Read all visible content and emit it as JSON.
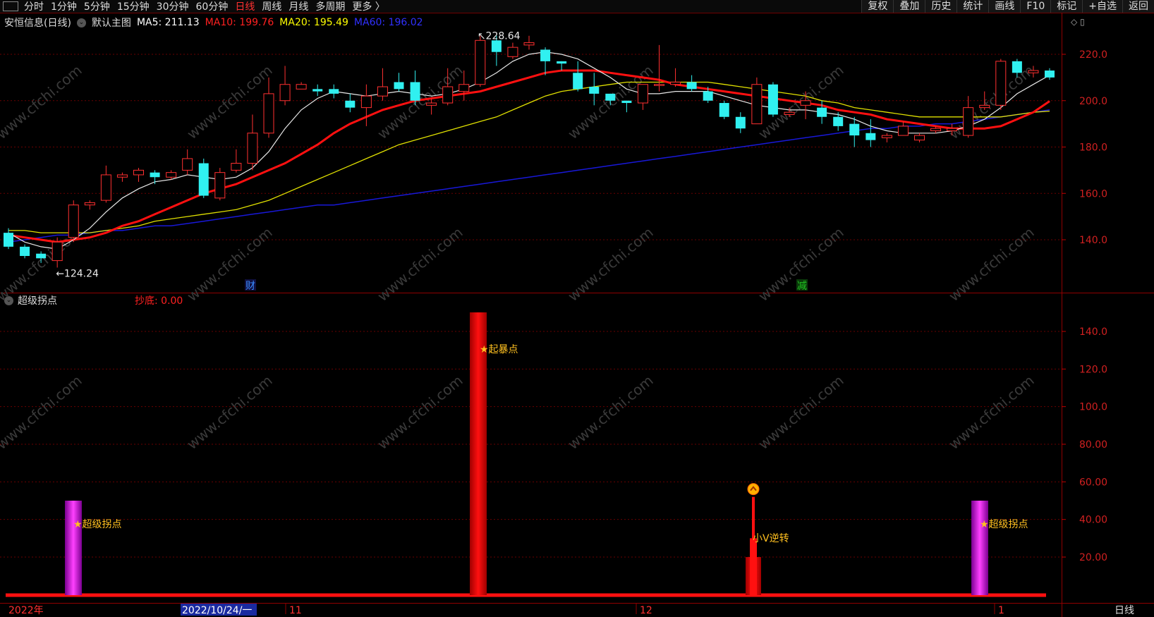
{
  "toolbar": {
    "periods": [
      "分时",
      "1分钟",
      "5分钟",
      "15分钟",
      "30分钟",
      "60分钟",
      "日线",
      "周线",
      "月线",
      "多周期",
      "更多 〉"
    ],
    "active_period": "日线",
    "actions": [
      "复权",
      "叠加",
      "历史",
      "统计",
      "画线",
      "F10",
      "标记",
      "+自选",
      "返回"
    ]
  },
  "main_chart": {
    "stock_title": "安恒信息(日线)",
    "template": "默认主图",
    "ma": [
      {
        "label": "MA5: 211.13",
        "color": "#ffffff"
      },
      {
        "label": "MA10: 199.76",
        "color": "#ff2020"
      },
      {
        "label": "MA20: 195.49",
        "color": "#ffff00"
      },
      {
        "label": "MA60: 196.02",
        "color": "#2020ff"
      }
    ],
    "high_marker": "228.64",
    "low_marker": "124.24",
    "y_ticks": [
      "220.0",
      "200.0",
      "180.0",
      "160.0",
      "140.0"
    ],
    "event_markers": [
      {
        "text": "财",
        "color": "#3a8cff"
      },
      {
        "text": "减",
        "color": "#20c020"
      }
    ]
  },
  "indicator": {
    "name": "超级拐点",
    "value_label": "抄底: 0.00",
    "y_ticks": [
      "140.0",
      "120.0",
      "100.0",
      "80.00",
      "60.00",
      "40.00",
      "20.00"
    ],
    "signals": [
      "★超级拐点",
      "★起暴点",
      "小V逆转",
      "★超级拐点"
    ],
    "bars": [
      {
        "label": "超级拐点",
        "value": 50
      },
      {
        "label": "起暴点",
        "value": 150
      },
      {
        "label": "小V逆转",
        "value": 55
      },
      {
        "label": "超级拐点",
        "value": 50
      }
    ]
  },
  "x_axis": {
    "labels": [
      "2022年",
      "2022/10/24/一",
      "11",
      "12",
      "1"
    ],
    "period_label": "日线"
  },
  "watermark": "www.cfchi.com",
  "chart_data": {
    "type": "candlestick",
    "ylim": [
      120,
      232
    ],
    "candles": [
      [
        143,
        137,
        145,
        136
      ],
      [
        137,
        133,
        138,
        132
      ],
      [
        134,
        132,
        135,
        130
      ],
      [
        131,
        139,
        141,
        128
      ],
      [
        141,
        155,
        157,
        139
      ],
      [
        155,
        156,
        157,
        153
      ],
      [
        157,
        168,
        172,
        156
      ],
      [
        167,
        168,
        169,
        165
      ],
      [
        168,
        170,
        171,
        165
      ],
      [
        169,
        167,
        170,
        164
      ],
      [
        167,
        169,
        170,
        166
      ],
      [
        170,
        175,
        179,
        168
      ],
      [
        173,
        159,
        175,
        158
      ],
      [
        158,
        169,
        171,
        157
      ],
      [
        170,
        173,
        179,
        169
      ],
      [
        173,
        186,
        194,
        170
      ],
      [
        186,
        203,
        210,
        184
      ],
      [
        200,
        207,
        215,
        198
      ],
      [
        205,
        207,
        208,
        205
      ],
      [
        205,
        204,
        207,
        202
      ],
      [
        205,
        203,
        207,
        201
      ],
      [
        200,
        197,
        203,
        195
      ],
      [
        197,
        202,
        207,
        189
      ],
      [
        202,
        206,
        214,
        200
      ],
      [
        208,
        205,
        212,
        204
      ],
      [
        208,
        200,
        213,
        198
      ],
      [
        198,
        199,
        201,
        194
      ],
      [
        199,
        206,
        214,
        198
      ],
      [
        204,
        207,
        213,
        200
      ],
      [
        207,
        226,
        228,
        206
      ],
      [
        226,
        221,
        228,
        215
      ],
      [
        219,
        223,
        225,
        218
      ],
      [
        224,
        225,
        228,
        222
      ],
      [
        222,
        217,
        223,
        211
      ],
      [
        217,
        216,
        217,
        213
      ],
      [
        212,
        205,
        217,
        204
      ],
      [
        206,
        203,
        212,
        198
      ],
      [
        203,
        200,
        203,
        198
      ],
      [
        200,
        199,
        200,
        195
      ],
      [
        199,
        207,
        207,
        196
      ],
      [
        207,
        207,
        224,
        204
      ],
      [
        207,
        208,
        214,
        206
      ],
      [
        208,
        205,
        211,
        204
      ],
      [
        204,
        200,
        206,
        199
      ],
      [
        199,
        193,
        200,
        192
      ],
      [
        193,
        188,
        195,
        186
      ],
      [
        190,
        207,
        210,
        190
      ],
      [
        207,
        194,
        208,
        193
      ],
      [
        194,
        195,
        197,
        193
      ],
      [
        198,
        200,
        204,
        192
      ],
      [
        197,
        193,
        200,
        190
      ],
      [
        193,
        189,
        195,
        187
      ],
      [
        190,
        185,
        193,
        180
      ],
      [
        186,
        183,
        192,
        180
      ],
      [
        184,
        185,
        186,
        182
      ],
      [
        185,
        189,
        191,
        185
      ],
      [
        183,
        185,
        186,
        182
      ],
      [
        187,
        188,
        189,
        186
      ],
      [
        187,
        188,
        190,
        185
      ],
      [
        185,
        197,
        202,
        184
      ],
      [
        197,
        198,
        204,
        196
      ],
      [
        198,
        217,
        218,
        196
      ],
      [
        217,
        212,
        218,
        210
      ],
      [
        212,
        213,
        215,
        210
      ],
      [
        213,
        210,
        214,
        209
      ]
    ],
    "ma5": [
      143,
      139,
      137,
      136,
      140,
      145,
      152,
      158,
      162,
      165,
      166,
      168,
      167,
      166,
      167,
      171,
      178,
      188,
      196,
      201,
      204,
      203,
      202,
      203,
      204,
      203,
      202,
      203,
      205,
      208,
      212,
      217,
      220,
      221,
      220,
      218,
      214,
      210,
      205,
      203,
      203,
      204,
      204,
      204,
      202,
      200,
      198,
      197,
      196,
      196,
      195,
      194,
      192,
      189,
      187,
      186,
      186,
      186,
      187,
      189,
      192,
      197,
      203,
      207,
      211
    ],
    "ma10": [
      142,
      141,
      140,
      139,
      140,
      141,
      143,
      146,
      148,
      151,
      154,
      157,
      160,
      162,
      164,
      167,
      170,
      173,
      177,
      181,
      186,
      190,
      193,
      196,
      198,
      200,
      201,
      202,
      203,
      204,
      206,
      208,
      210,
      212,
      213,
      213,
      213,
      212,
      211,
      210,
      209,
      207,
      206,
      205,
      204,
      203,
      202,
      201,
      200,
      199,
      198,
      196,
      195,
      194,
      192,
      191,
      190,
      189,
      188,
      188,
      188,
      189,
      192,
      195,
      199.76
    ],
    "ma20": [
      144,
      144,
      143,
      143,
      143,
      143,
      144,
      145,
      146,
      148,
      149,
      150,
      151,
      152,
      153,
      155,
      157,
      160,
      163,
      166,
      169,
      172,
      175,
      178,
      181,
      183,
      185,
      187,
      189,
      191,
      193,
      196,
      199,
      202,
      204,
      205,
      206,
      207,
      208,
      208,
      208,
      208,
      208,
      208,
      207,
      206,
      205,
      204,
      203,
      202,
      200,
      199,
      197,
      196,
      195,
      194,
      193,
      193,
      193,
      193,
      193,
      193,
      194,
      195,
      195.49
    ],
    "ma60": [
      139,
      140,
      141,
      142,
      142,
      143,
      144,
      144,
      145,
      146,
      146,
      147,
      148,
      149,
      150,
      151,
      152,
      153,
      154,
      155,
      155,
      156,
      157,
      158,
      159,
      160,
      161,
      162,
      163,
      164,
      165,
      166,
      167,
      168,
      169,
      170,
      171,
      172,
      173,
      174,
      175,
      176,
      177,
      178,
      179,
      180,
      181,
      182,
      183,
      184,
      185,
      186,
      187,
      188,
      188,
      189,
      189,
      190,
      190,
      191,
      192,
      193,
      194,
      195,
      196.02
    ]
  }
}
